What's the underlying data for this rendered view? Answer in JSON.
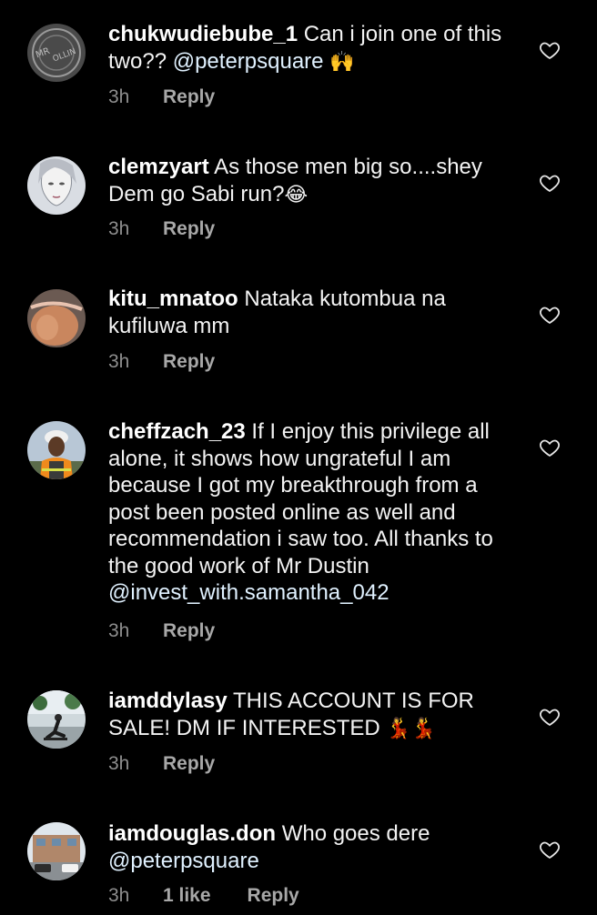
{
  "colors": {
    "background": "#000000",
    "text": "#f3f3f3",
    "muted": "#8e8e8e",
    "mention": "#e0f1ff"
  },
  "comments": [
    {
      "username": "chukwudiebube_1",
      "text_before": "Can i join one of this two?? ",
      "mention": "@peterpsquare",
      "text_after": " ",
      "emoji": "🙌",
      "time": "3h",
      "reply": "Reply",
      "avatar": "stamp-avatar"
    },
    {
      "username": "clemzyart",
      "text_before": "As those men big so....shey Dem go Sabi run?",
      "mention": "",
      "text_after": "",
      "emoji": "😂",
      "time": "3h",
      "reply": "Reply",
      "avatar": "sketch-face-avatar"
    },
    {
      "username": "kitu_mnatoo",
      "text_before": "Nataka kutombua na kufiluwa mm",
      "mention": "",
      "text_after": "",
      "emoji": "",
      "time": "3h",
      "reply": "Reply",
      "avatar": "photo-avatar"
    },
    {
      "username": "cheffzach_23",
      "text_before": "If I enjoy this privilege all alone, it shows how ungrateful I am because I got my breakthrough from a post been posted online as well and recommendation i saw too. All thanks to the good work of Mr Dustin ",
      "mention": "@invest_with.samantha_042",
      "text_after": "",
      "emoji": "",
      "time": "3h",
      "reply": "Reply",
      "avatar": "hardhat-person-avatar"
    },
    {
      "username": "iamddylasy",
      "text_before": "THIS ACCOUNT IS FOR SALE! DM IF INTERESTED",
      "mention": "",
      "text_after": "",
      "emoji": "💃💃",
      "time": "3h",
      "reply": "Reply",
      "avatar": "skater-avatar"
    },
    {
      "username": "iamdouglas.don",
      "text_before": "Who goes dere ",
      "mention": "@peterpsquare",
      "text_after": "",
      "emoji": "",
      "time": "3h",
      "likes": "1 like",
      "reply": "Reply",
      "avatar": "building-avatar"
    }
  ]
}
